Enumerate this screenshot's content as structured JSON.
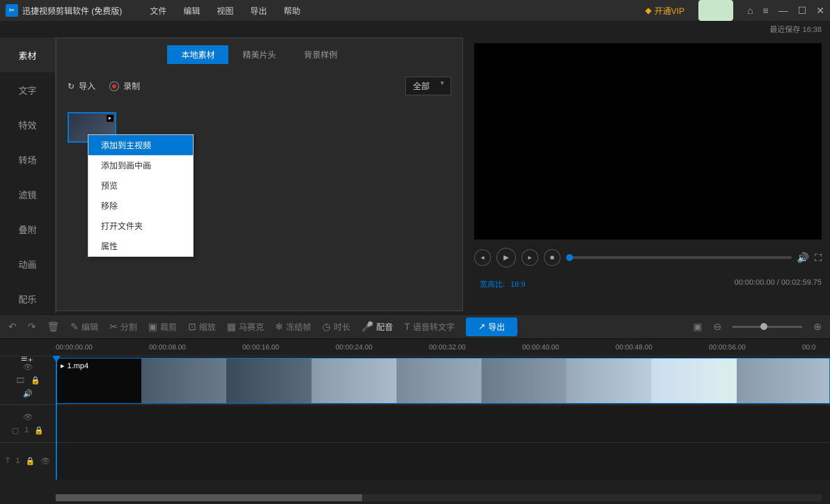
{
  "titlebar": {
    "app_title": "迅捷视频剪辑软件 (免费版)",
    "menu": [
      "文件",
      "编辑",
      "视图",
      "导出",
      "帮助"
    ],
    "vip_label": "开通VIP"
  },
  "save_status": {
    "label": "最近保存",
    "time": "16:38"
  },
  "sidebar": {
    "tabs": [
      "素材",
      "文字",
      "特效",
      "转场",
      "滤镜",
      "叠附",
      "动画",
      "配乐"
    ]
  },
  "media_panel": {
    "tabs": [
      "本地素材",
      "精美片头",
      "背景样例"
    ],
    "import_label": "导入",
    "record_label": "录制",
    "filter_label": "全部"
  },
  "context_menu": {
    "items": [
      "添加到主视频",
      "添加到画中画",
      "预览",
      "移除",
      "打开文件夹",
      "属性"
    ]
  },
  "preview": {
    "ratio_label": "宽高比:",
    "ratio_value": "16:9",
    "current_time": "00:00:00.00",
    "total_time": "00:02:59.75"
  },
  "toolbar": {
    "undo": "↶",
    "redo": "↷",
    "delete": "🗑",
    "edit": "编辑",
    "split": "分割",
    "crop": "裁剪",
    "zoom": "缩放",
    "mosaic": "马赛克",
    "freeze": "冻结帧",
    "duration": "时长",
    "voiceover": "配音",
    "speech2text": "语音转文字",
    "export": "导出"
  },
  "timeline": {
    "ticks": [
      "00:00:00.00",
      "00:00:08.00",
      "00:00:16.00",
      "00:00:24.00",
      "00:00:32.00",
      "00:00:40.00",
      "00:00:48.00",
      "00:00:56.00",
      "00:0"
    ],
    "clip_name": "1.mp4"
  }
}
